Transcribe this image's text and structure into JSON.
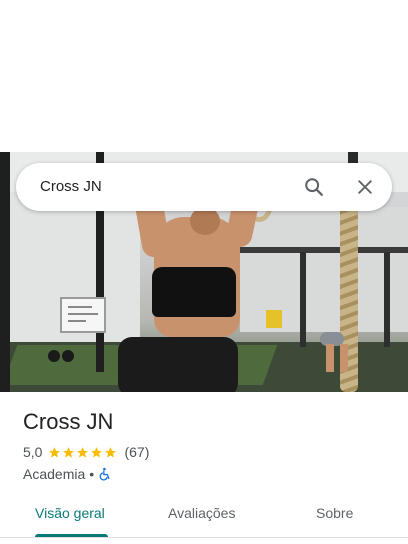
{
  "search": {
    "query": "Cross JN"
  },
  "place": {
    "name": "Cross JN",
    "rating": "5,0",
    "stars": 5,
    "review_count": "(67)",
    "category": "Academia",
    "separator": "•"
  },
  "tabs": [
    {
      "label": "Visão geral",
      "active": true
    },
    {
      "label": "Avaliações",
      "active": false
    },
    {
      "label": "Sobre",
      "active": false
    }
  ],
  "colors": {
    "accent": "#0b7a75",
    "star": "#fbbc04",
    "accessibility": "#1a73e8"
  },
  "icons": [
    "search-icon",
    "close-icon",
    "star-icon",
    "wheelchair-accessible-icon"
  ]
}
